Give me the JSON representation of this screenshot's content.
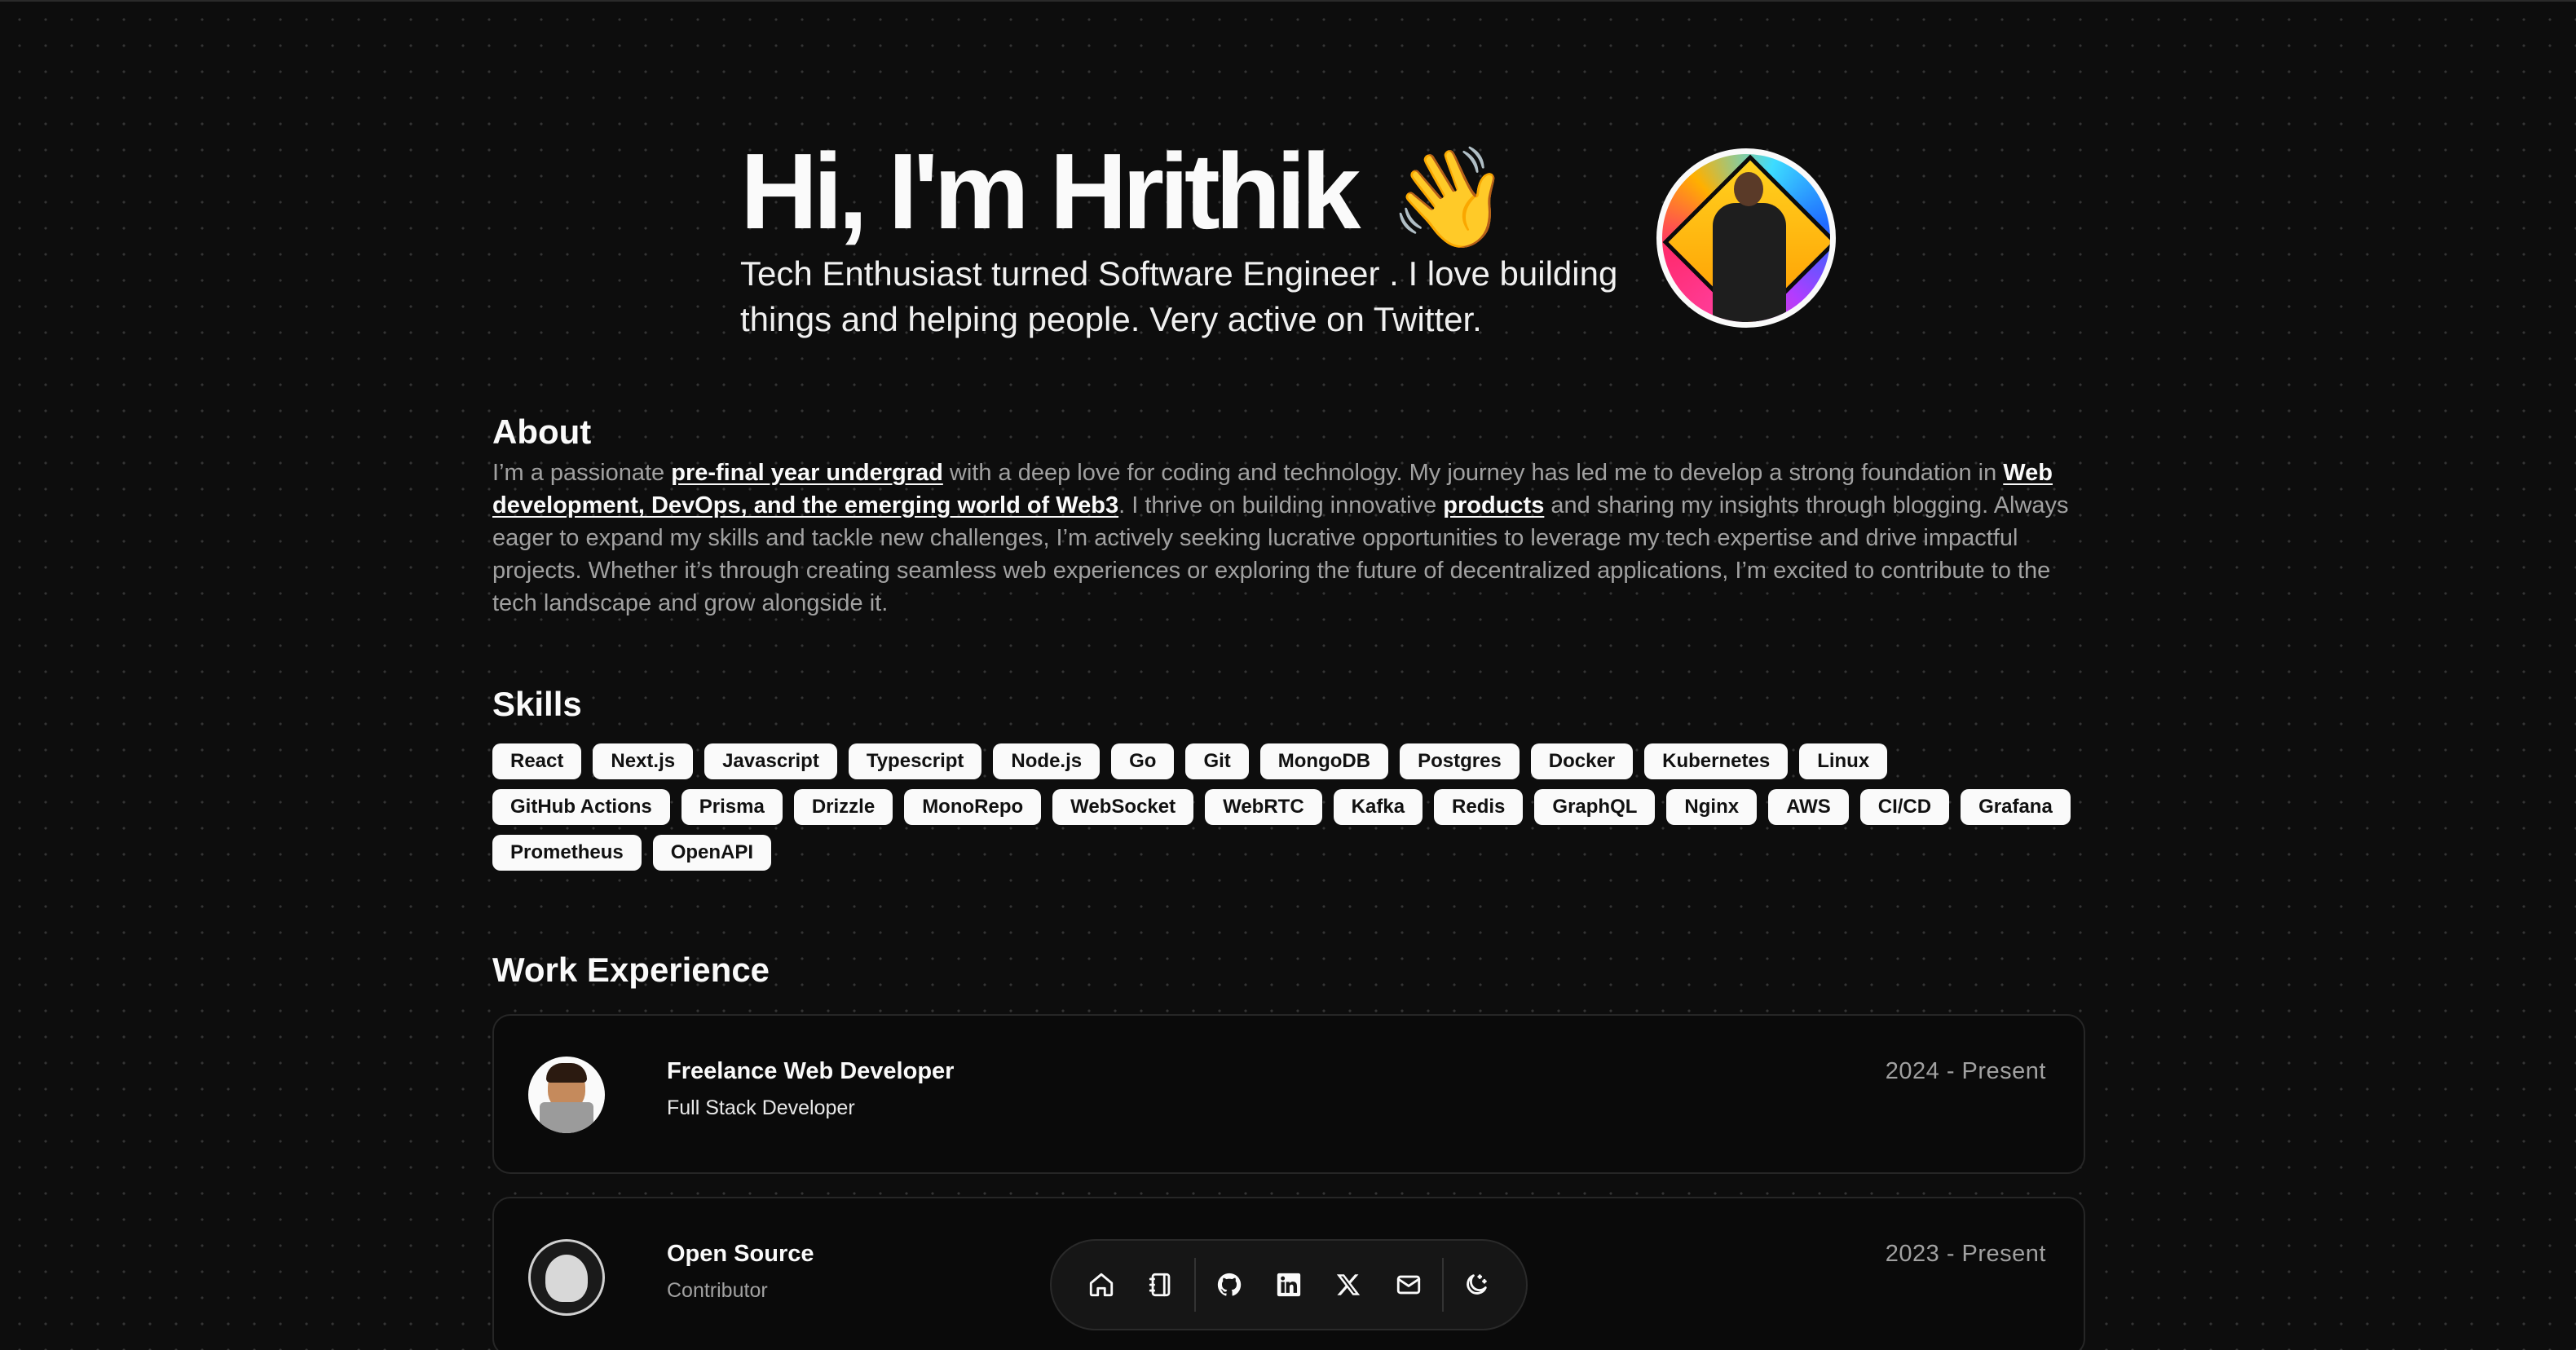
{
  "hero": {
    "greeting": "Hi, I'm Hrithik",
    "wave_emoji": "👋",
    "subtitle": "Tech Enthusiast turned Software Engineer . I love building things and helping people. Very active on Twitter."
  },
  "about": {
    "heading": "About",
    "t1": "I’m a passionate ",
    "link1": "pre-final year undergrad",
    "t2": " with a deep love for coding and technology. My journey has led me to develop a strong foundation in ",
    "link2": "Web development, DevOps, and the emerging world of Web3",
    "t3": ". I thrive on building innovative ",
    "link3": "products",
    "t4": " and sharing my insights through blogging. Always eager to expand my skills and tackle new challenges, I’m actively seeking lucrative opportunities to leverage my tech expertise and drive impactful projects. Whether it’s through creating seamless web experiences or exploring the future of decentralized applications, I’m excited to contribute to the tech landscape and grow alongside it."
  },
  "skills": {
    "heading": "Skills",
    "items": [
      "React",
      "Next.js",
      "Javascript",
      "Typescript",
      "Node.js",
      "Go",
      "Git",
      "MongoDB",
      "Postgres",
      "Docker",
      "Kubernetes",
      "Linux",
      "GitHub Actions",
      "Prisma",
      "Drizzle",
      "MonoRepo",
      "WebSocket",
      "WebRTC",
      "Kafka",
      "Redis",
      "GraphQL",
      "Nginx",
      "AWS",
      "CI/CD",
      "Grafana",
      "Prometheus",
      "OpenAPI"
    ]
  },
  "work": {
    "heading": "Work Experience",
    "jobs": [
      {
        "title": "Freelance Web Developer",
        "role": "Full Stack Developer",
        "date": "2024 - Present"
      },
      {
        "title": "Open Source",
        "role": "Contributor",
        "date": "2023 - Present"
      }
    ]
  },
  "dock": {
    "items": [
      "home-icon",
      "notebook-icon",
      "github-icon",
      "linkedin-icon",
      "x-icon",
      "mail-icon",
      "theme-toggle-icon"
    ]
  }
}
